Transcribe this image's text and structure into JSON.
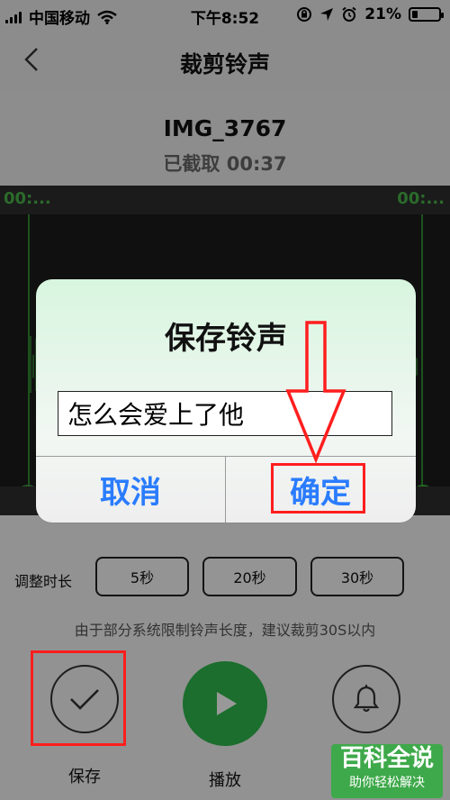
{
  "status_bar": {
    "carrier": "中国移动",
    "time": "下午8:52",
    "battery_percent_text": "21%",
    "battery_level": 0.21,
    "icons": [
      "signal-icon",
      "wifi-icon",
      "lock-rotation-icon",
      "location-icon",
      "alarm-icon",
      "battery-icon"
    ]
  },
  "nav": {
    "title": "裁剪铃声",
    "back_icon": "chevron-left-icon"
  },
  "song": {
    "title": "IMG_3767",
    "cut_text": "已截取 00:37"
  },
  "waveform": {
    "time_left": "00:...",
    "time_right": "00:..."
  },
  "controls": {
    "duration_label": "调整时长",
    "duration_options": [
      "5秒",
      "20秒",
      "30秒"
    ],
    "hint": "由于部分系统限制铃声长度，建议裁剪30S以内",
    "save_label": "保存",
    "play_label": "播放",
    "icons": [
      "check-icon",
      "play-icon",
      "bell-icon"
    ]
  },
  "dialog": {
    "title": "保存铃声",
    "input_value": "怎么会爱上了他",
    "cancel_label": "取消",
    "ok_label": "确定"
  },
  "watermark": {
    "top": "百科全说",
    "bottom": "助你轻松解决"
  },
  "colors": {
    "accent_green": "#2eb74c",
    "wave_green": "#49b249",
    "dialog_button_blue": "#2a7cff",
    "annotation_red": "#ff1e1e"
  }
}
